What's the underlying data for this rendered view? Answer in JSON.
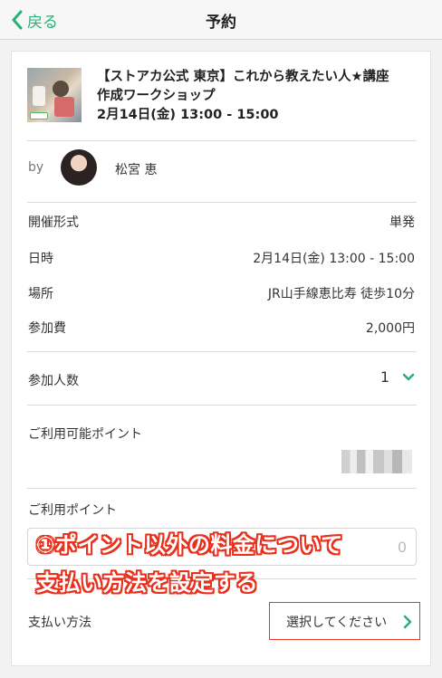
{
  "navbar": {
    "back_label": "戻る",
    "title": "予約"
  },
  "event": {
    "title_line1": "【ストアカ公式 東京】これから教えたい人★講座",
    "title_line2": "作成ワークショップ",
    "datetime": "2月14日(金) 13:00 - 15:00"
  },
  "host": {
    "by_label": "by",
    "name": "松宮 恵"
  },
  "details": {
    "format_label": "開催形式",
    "format_value": "単発",
    "date_label": "日時",
    "date_value": "2月14日(金) 13:00 - 15:00",
    "place_label": "場所",
    "place_value": "JR山手線恵比寿 徒歩10分",
    "fee_label": "参加費",
    "fee_value": "2,000円"
  },
  "participants": {
    "label": "参加人数",
    "value": "1"
  },
  "points": {
    "available_label": "ご利用可能ポイント",
    "use_label": "ご利用ポイント",
    "input_placeholder": "0"
  },
  "annotation": {
    "line1": "①ポイント以外の料金について",
    "line2": "支払い方法を設定する"
  },
  "payment": {
    "label": "支払い方法",
    "select_label": "選択してください"
  },
  "colors": {
    "accent_green": "#27b174",
    "highlight_red": "#e63a2a"
  }
}
